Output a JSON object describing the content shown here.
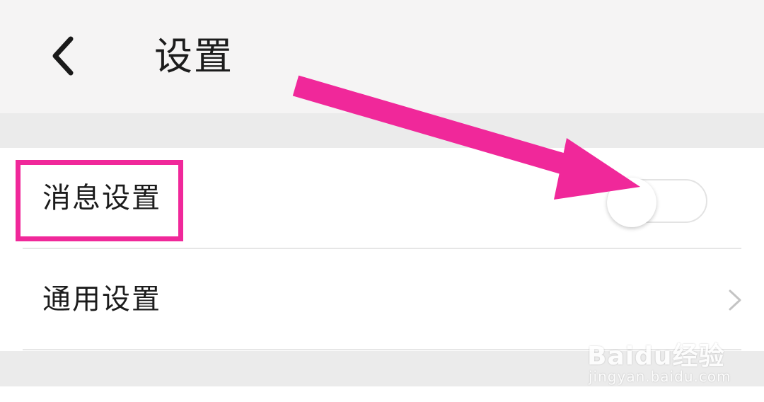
{
  "header": {
    "title": "设置",
    "back_icon": "chevron-left-icon"
  },
  "settings": {
    "items": [
      {
        "label": "消息设置",
        "control": "toggle",
        "toggle_on": false
      },
      {
        "label": "通用设置",
        "control": "chevron",
        "icon": "chevron-right-icon"
      }
    ]
  },
  "annotations": {
    "color": "#f0289a"
  },
  "watermark": {
    "brand": "Baidu经验",
    "url": "jingyan.baidu.com"
  }
}
